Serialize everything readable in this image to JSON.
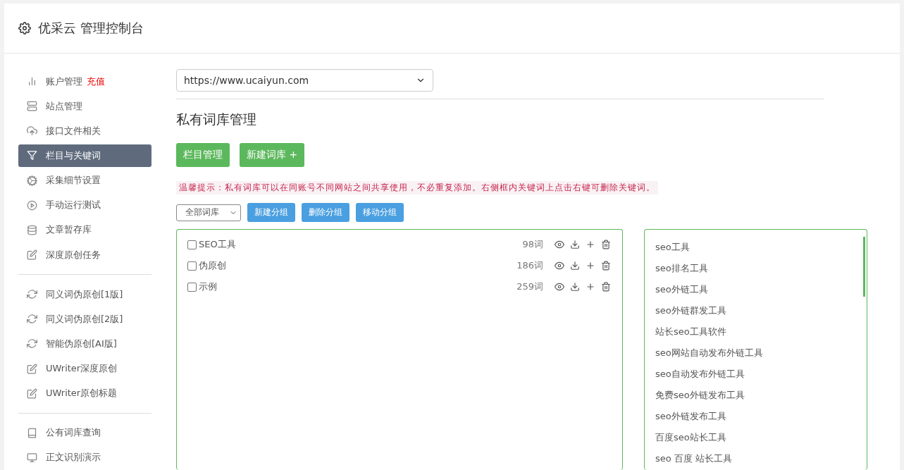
{
  "header": {
    "title": "优采云 管理控制台"
  },
  "sidebar": {
    "groups": [
      {
        "items": [
          {
            "label": "账户管理",
            "badge": "充值",
            "selected": false
          },
          {
            "label": "站点管理",
            "selected": false
          },
          {
            "label": "接口文件相关",
            "selected": false
          },
          {
            "label": "栏目与关键词",
            "selected": true
          },
          {
            "label": "采集细节设置",
            "selected": false
          },
          {
            "label": "手动运行测试",
            "selected": false
          },
          {
            "label": "文章暂存库",
            "selected": false
          },
          {
            "label": "深度原创任务",
            "selected": false
          }
        ]
      },
      {
        "items": [
          {
            "label": "同义词伪原创[1版]",
            "selected": false
          },
          {
            "label": "同义词伪原创[2版]",
            "selected": false
          },
          {
            "label": "智能伪原创[AI版]",
            "selected": false
          },
          {
            "label": "UWriter深度原创",
            "selected": false
          },
          {
            "label": "UWriter原创标题",
            "selected": false
          }
        ]
      },
      {
        "items": [
          {
            "label": "公有词库查询",
            "selected": false
          },
          {
            "label": "正文识别演示",
            "selected": false
          }
        ]
      }
    ]
  },
  "site_select": {
    "value": "https://www.ucaiyun.com"
  },
  "section_title": "私有词库管理",
  "primary_buttons": [
    "栏目管理",
    "新建词库 +"
  ],
  "tip": "温馨提示：私有词库可以在同账号不同网站之间共享使用，不必重复添加。右侧框内关键词上点击右键可删除关键词。",
  "group_select": {
    "value": "全部词库"
  },
  "group_buttons": [
    "新建分组",
    "删除分组",
    "移动分组"
  ],
  "libraries": [
    {
      "name": "SEO工具",
      "count": "98词",
      "checked": false
    },
    {
      "name": "伪原创",
      "count": "186词",
      "checked": false
    },
    {
      "name": "示例",
      "count": "259词",
      "checked": false
    }
  ],
  "keywords": [
    "seo工具",
    "seo排名工具",
    "seo外链工具",
    "seo外链群发工具",
    "站长seo工具软件",
    "seo网站自动发布外链工具",
    "seo自动发布外链工具",
    "免费seo外链发布工具",
    "seo外链发布工具",
    "百度seo站长工具",
    "seo 百度 站长工具"
  ]
}
